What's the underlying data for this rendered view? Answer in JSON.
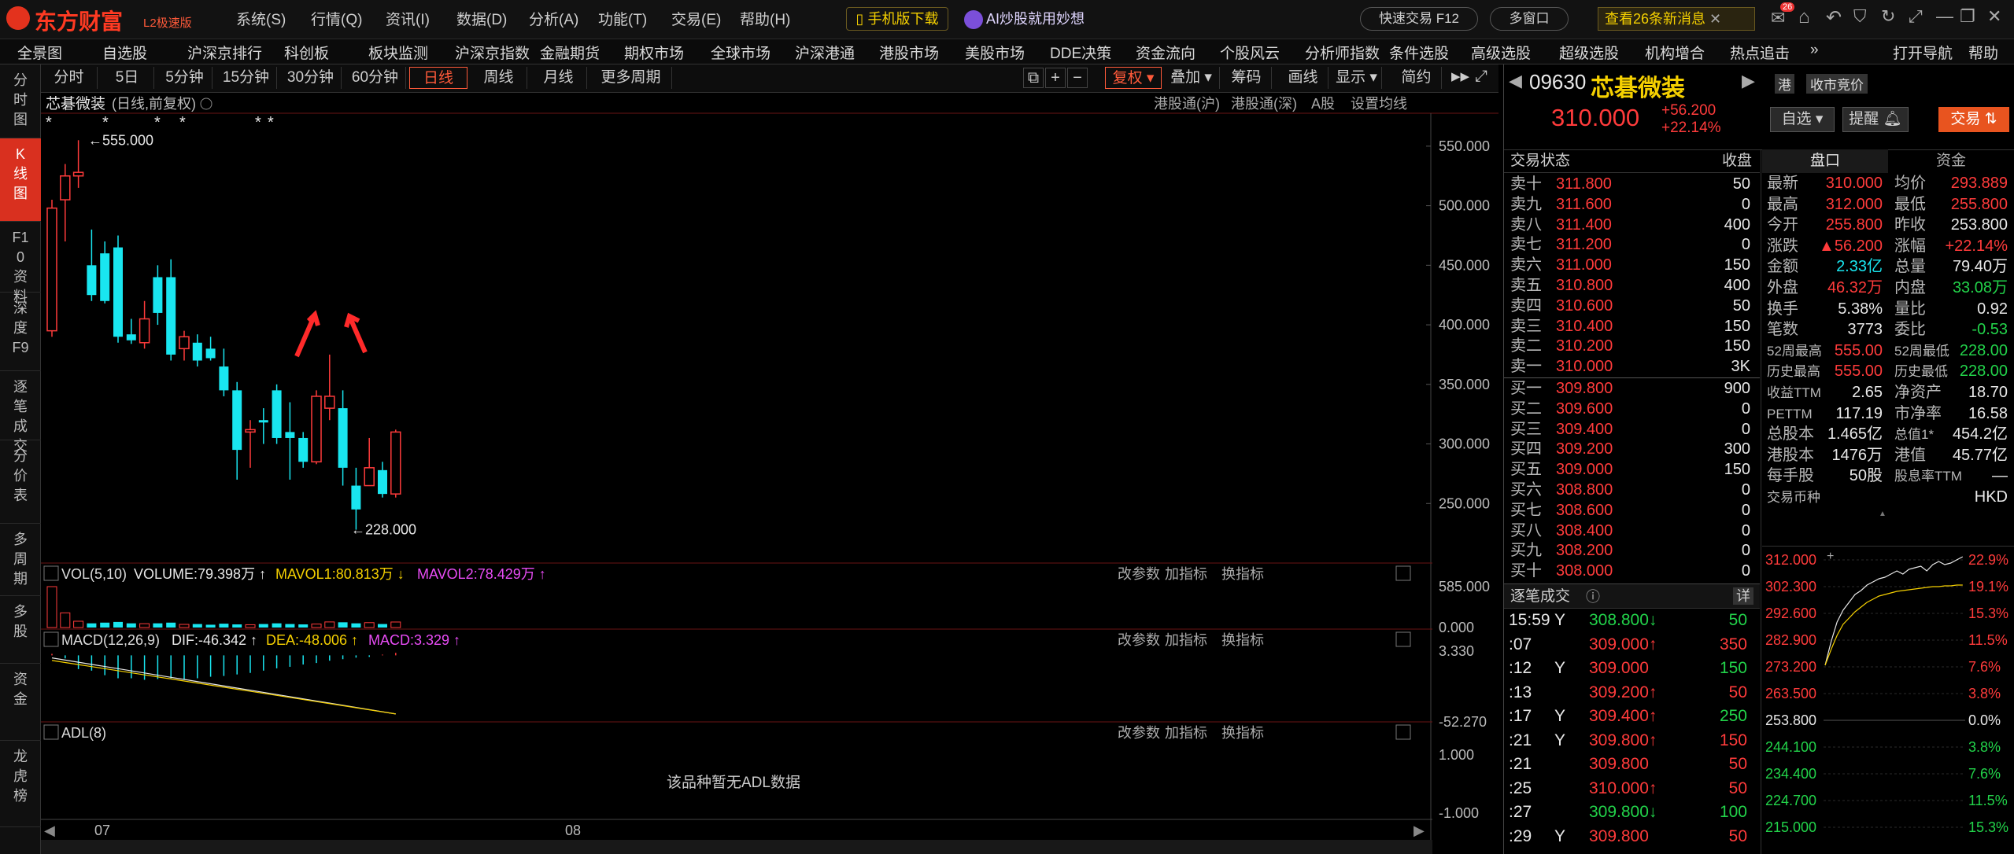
{
  "app": {
    "brand": "东方财富",
    "edition": "L2极速版"
  },
  "topmenu": [
    "系统(S)",
    "行情(Q)",
    "资讯(I)",
    "数据(D)",
    "分析(A)",
    "功能(T)",
    "交易(E)",
    "帮助(H)"
  ],
  "title_actions": {
    "mobile": "手机版下载",
    "ai": "AI炒股就用妙想",
    "quick_trade": "快速交易 F12",
    "multi_window": "多窗口",
    "news": "查看26条新消息",
    "badge": "26"
  },
  "menubar": [
    "全景图",
    "自选股",
    "沪深京排行",
    "科创板",
    "板块监测",
    "沪深京指数",
    "金融期货",
    "期权市场",
    "全球市场",
    "沪深港通",
    "港股市场",
    "美股市场",
    "DDE决策",
    "资金流向",
    "个股风云",
    "分析师指数",
    "条件选股",
    "高级选股",
    "超级选股",
    "机构增合",
    "热点追击",
    "»",
    "打开导航",
    "帮助"
  ],
  "leftnav": [
    "分时图",
    "K线图",
    "F10资料",
    "深度F9",
    "逐笔成交",
    "分价表",
    "多周期",
    "多股",
    "资金",
    "龙虎榜"
  ],
  "chart_toolbar": {
    "periods": [
      "分时",
      "5日",
      "5分钟",
      "15分钟",
      "30分钟",
      "60分钟",
      "日线",
      "周线",
      "月线",
      "更多周期"
    ],
    "active": "日线",
    "tools": [
      "复权",
      "叠加",
      "筹码",
      "画线",
      "显示",
      "简约"
    ]
  },
  "chart_header": {
    "name": "芯碁微装",
    "mode": "(日线,前复权)",
    "links": [
      "港股通(沪)",
      "港股通(深)",
      "A股",
      "设置均线"
    ]
  },
  "chart_data": [
    {
      "type": "candlestick",
      "name": "芯碁微装",
      "yaxis": [
        "550.000",
        "500.000",
        "450.000",
        "400.000",
        "350.000",
        "300.000",
        "250.000"
      ],
      "ylim": [
        200,
        575
      ],
      "xticks": [
        "07",
        "08"
      ],
      "high_label": "555.000",
      "low_label": "228.000",
      "candles": [
        {
          "o": 395,
          "h": 505,
          "l": 390,
          "c": 498
        },
        {
          "o": 505,
          "h": 535,
          "l": 470,
          "c": 525
        },
        {
          "o": 525,
          "h": 555,
          "l": 515,
          "c": 528
        },
        {
          "o": 450,
          "h": 480,
          "l": 420,
          "c": 425
        },
        {
          "o": 460,
          "h": 470,
          "l": 418,
          "c": 420
        },
        {
          "o": 465,
          "h": 475,
          "l": 385,
          "c": 390
        },
        {
          "o": 392,
          "h": 405,
          "l": 384,
          "c": 387
        },
        {
          "o": 385,
          "h": 420,
          "l": 380,
          "c": 405
        },
        {
          "o": 440,
          "h": 450,
          "l": 400,
          "c": 410
        },
        {
          "o": 440,
          "h": 455,
          "l": 370,
          "c": 375
        },
        {
          "o": 380,
          "h": 395,
          "l": 370,
          "c": 390
        },
        {
          "o": 385,
          "h": 392,
          "l": 365,
          "c": 370
        },
        {
          "o": 380,
          "h": 390,
          "l": 370,
          "c": 372
        },
        {
          "o": 365,
          "h": 380,
          "l": 340,
          "c": 345
        },
        {
          "o": 345,
          "h": 352,
          "l": 270,
          "c": 295
        },
        {
          "o": 310,
          "h": 320,
          "l": 280,
          "c": 312
        },
        {
          "o": 320,
          "h": 330,
          "l": 300,
          "c": 318
        },
        {
          "o": 345,
          "h": 350,
          "l": 300,
          "c": 305
        },
        {
          "o": 310,
          "h": 335,
          "l": 270,
          "c": 305
        },
        {
          "o": 305,
          "h": 310,
          "l": 280,
          "c": 285
        },
        {
          "o": 285,
          "h": 345,
          "l": 283,
          "c": 340
        },
        {
          "o": 330,
          "h": 375,
          "l": 320,
          "c": 340
        },
        {
          "o": 330,
          "h": 345,
          "l": 265,
          "c": 280
        },
        {
          "o": 265,
          "h": 280,
          "l": 228,
          "c": 245
        },
        {
          "o": 265,
          "h": 305,
          "l": 265,
          "c": 280
        },
        {
          "o": 278,
          "h": 285,
          "l": 255,
          "c": 258
        },
        {
          "o": 258,
          "h": 312,
          "l": 255,
          "c": 310
        }
      ]
    },
    {
      "type": "bar",
      "name": "VOL",
      "series_label": "VOL(5,10)",
      "volume": "VOLUME:79.398万",
      "mavol1": "MAVOL1:80.813万",
      "mavol2": "MAVOL2:78.429万",
      "yaxis": [
        "585.000",
        "0.000"
      ],
      "values": [
        585,
        210,
        90,
        60,
        70,
        80,
        60,
        55,
        60,
        70,
        45,
        50,
        40,
        55,
        45,
        40,
        50,
        60,
        50,
        45,
        50,
        80,
        75,
        60,
        70,
        50,
        79
      ]
    },
    {
      "type": "bar",
      "name": "MACD",
      "series_label": "MACD(12,26,9)",
      "dif": "DIF:-46.342",
      "dea": "DEA:-48.006",
      "macd": "MACD:3.329",
      "yaxis": [
        "3.330",
        "-52.270"
      ],
      "values": [
        2,
        -4,
        -18,
        -20,
        -26,
        -30,
        -30,
        -32,
        -31,
        -30,
        -32,
        -30,
        -28,
        -27,
        -25,
        -23,
        -20,
        -17,
        -15,
        -12,
        -10,
        -7,
        -5,
        -3,
        -2,
        1,
        3.3
      ]
    },
    {
      "type": "line",
      "name": "ADL",
      "series_label": "ADL(8)",
      "yaxis": [
        "1.000",
        "-1.000"
      ],
      "note": "该品种暂无ADL数据"
    }
  ],
  "panel_actions": [
    "改参数",
    "加指标",
    "换指标"
  ],
  "stock": {
    "code": "09630",
    "name": "芯碁微装",
    "market": "港",
    "auction": "收市竞价",
    "price": "310.000",
    "change": "+56.200",
    "pct": "+22.14%",
    "btn_watch": "自选",
    "btn_alert": "提醒",
    "btn_trade": "交易"
  },
  "orderbook": {
    "header": "交易状态",
    "status": "收盘",
    "asks": [
      [
        "卖十",
        "311.800",
        "50"
      ],
      [
        "卖九",
        "311.600",
        "0"
      ],
      [
        "卖八",
        "311.400",
        "400"
      ],
      [
        "卖七",
        "311.200",
        "0"
      ],
      [
        "卖六",
        "311.000",
        "150"
      ],
      [
        "卖五",
        "310.800",
        "400"
      ],
      [
        "卖四",
        "310.600",
        "50"
      ],
      [
        "卖三",
        "310.400",
        "150"
      ],
      [
        "卖二",
        "310.200",
        "150"
      ],
      [
        "卖一",
        "310.000",
        "3K"
      ]
    ],
    "bids": [
      [
        "买一",
        "309.800",
        "900"
      ],
      [
        "买二",
        "309.600",
        "0"
      ],
      [
        "买三",
        "309.400",
        "0"
      ],
      [
        "买四",
        "309.200",
        "300"
      ],
      [
        "买五",
        "309.000",
        "150"
      ],
      [
        "买六",
        "308.800",
        "0"
      ],
      [
        "买七",
        "308.600",
        "0"
      ],
      [
        "买八",
        "308.400",
        "0"
      ],
      [
        "买九",
        "308.200",
        "0"
      ],
      [
        "买十",
        "308.000",
        "0"
      ]
    ]
  },
  "tabs": [
    "盘口",
    "资金"
  ],
  "stats": [
    [
      "最新",
      "310.000",
      "red",
      "均价",
      "293.889",
      "red"
    ],
    [
      "最高",
      "312.000",
      "red",
      "最低",
      "255.800",
      "red"
    ],
    [
      "今开",
      "255.800",
      "red",
      "昨收",
      "253.800",
      "wht"
    ],
    [
      "涨跌",
      "▲56.200",
      "red",
      "涨幅",
      "+22.14%",
      "red"
    ],
    [
      "金额",
      "2.33亿",
      "cy",
      "总量",
      "79.40万",
      "wht"
    ],
    [
      "外盘",
      "46.32万",
      "red",
      "内盘",
      "33.08万",
      "grn"
    ],
    [
      "换手",
      "5.38%",
      "wht",
      "量比",
      "0.92",
      "wht"
    ],
    [
      "笔数",
      "3773",
      "wht",
      "委比",
      "-0.53",
      "grn"
    ],
    [
      "52周最高",
      "555.00",
      "red",
      "52周最低",
      "228.00",
      "grn"
    ],
    [
      "历史最高",
      "555.00",
      "red",
      "历史最低",
      "228.00",
      "grn"
    ],
    [
      "收益TTM",
      "2.65",
      "wht",
      "净资产",
      "18.70",
      "wht"
    ],
    [
      "PETTM",
      "117.19",
      "wht",
      "市净率",
      "16.58",
      "wht"
    ],
    [
      "总股本",
      "1.465亿",
      "wht",
      "总值1*",
      "454.2亿",
      "wht"
    ],
    [
      "港股本",
      "1476万",
      "wht",
      "港值",
      "45.77亿",
      "wht"
    ],
    [
      "每手股",
      "50股",
      "wht",
      "股息率TTM",
      "—",
      "wht"
    ],
    [
      "交易币种",
      "",
      "wht",
      "",
      "HKD",
      "wht"
    ]
  ],
  "trades_header": "逐笔成交",
  "trades_detail": "详",
  "trades": [
    [
      "15:59",
      "Y",
      "308.800",
      "↓",
      "50",
      "grn"
    ],
    [
      ":07",
      "",
      "309.000",
      "↑",
      "350",
      "red"
    ],
    [
      ":12",
      "Y",
      "309.000",
      "",
      "150",
      "grn"
    ],
    [
      ":13",
      "",
      "309.200",
      "↑",
      "50",
      "red"
    ],
    [
      ":17",
      "Y",
      "309.400",
      "↑",
      "250",
      "grn"
    ],
    [
      ":21",
      "Y",
      "309.800",
      "↑",
      "150",
      "red"
    ],
    [
      ":21",
      "",
      "309.800",
      "",
      "50",
      "red"
    ],
    [
      ":25",
      "",
      "310.000",
      "↑",
      "50",
      "red"
    ],
    [
      ":27",
      "",
      "309.800",
      "↓",
      "100",
      "grn"
    ],
    [
      ":29",
      "Y",
      "309.800",
      "",
      "50",
      "red"
    ]
  ],
  "mini_chart": {
    "ylabels": [
      "312.000",
      "302.300",
      "292.600",
      "282.900",
      "273.200",
      "263.500",
      "253.800",
      "244.100",
      "234.400",
      "224.700",
      "215.000"
    ],
    "pcts": [
      "22.9%",
      "19.1%",
      "15.3%",
      "11.5%",
      "7.6%",
      "3.8%",
      "0.0%",
      "3.8%",
      "7.6%",
      "11.5%",
      "15.3%"
    ]
  }
}
